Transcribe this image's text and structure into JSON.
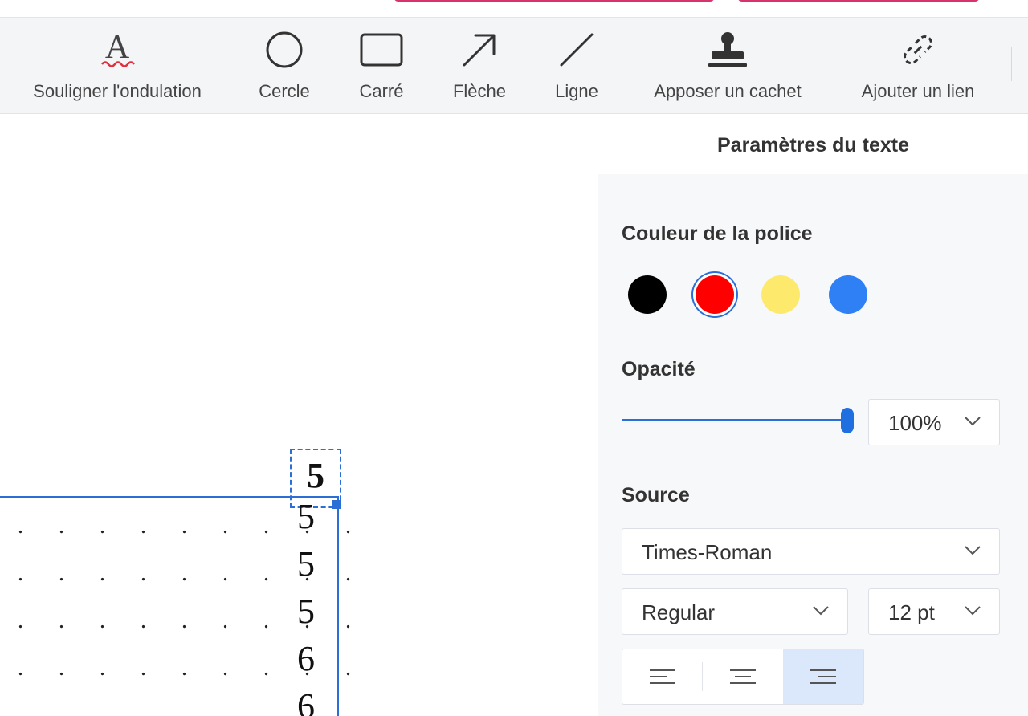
{
  "toolbar": {
    "items": [
      {
        "label": "Souligner l'ondulation",
        "icon": "wavy-underline-icon"
      },
      {
        "label": "Cercle",
        "icon": "circle-icon"
      },
      {
        "label": "Carré",
        "icon": "square-icon"
      },
      {
        "label": "Flèche",
        "icon": "arrow-icon"
      },
      {
        "label": "Ligne",
        "icon": "line-icon"
      },
      {
        "label": "Apposer un cachet",
        "icon": "stamp-icon"
      },
      {
        "label": "Ajouter un lien",
        "icon": "link-icon"
      }
    ]
  },
  "document": {
    "selected_text": "5",
    "toc_page_numbers": [
      "5",
      "5",
      "5",
      "6",
      "6"
    ],
    "leader": ". . . . . . . . ."
  },
  "panel": {
    "title": "Paramètres du texte",
    "font_color_label": "Couleur de la police",
    "colors": [
      {
        "name": "black",
        "hex": "#000000",
        "selected": false
      },
      {
        "name": "red",
        "hex": "#ff0000",
        "selected": true
      },
      {
        "name": "yellow",
        "hex": "#fde96c",
        "selected": false
      },
      {
        "name": "blue",
        "hex": "#2f80f5",
        "selected": false
      }
    ],
    "opacity_label": "Opacité",
    "opacity_value": "100%",
    "opacity_level": 1.0,
    "source_label": "Source",
    "font_family": "Times-Roman",
    "font_style": "Regular",
    "font_size": "12 pt",
    "alignment_options": [
      "align-left",
      "align-center",
      "align-right"
    ],
    "alignment_selected": "align-right"
  },
  "colors": {
    "accent": "#2b6fd6",
    "selected_alignment_bg": "#dbe7fb",
    "wavy_underline": "#e0303d"
  }
}
